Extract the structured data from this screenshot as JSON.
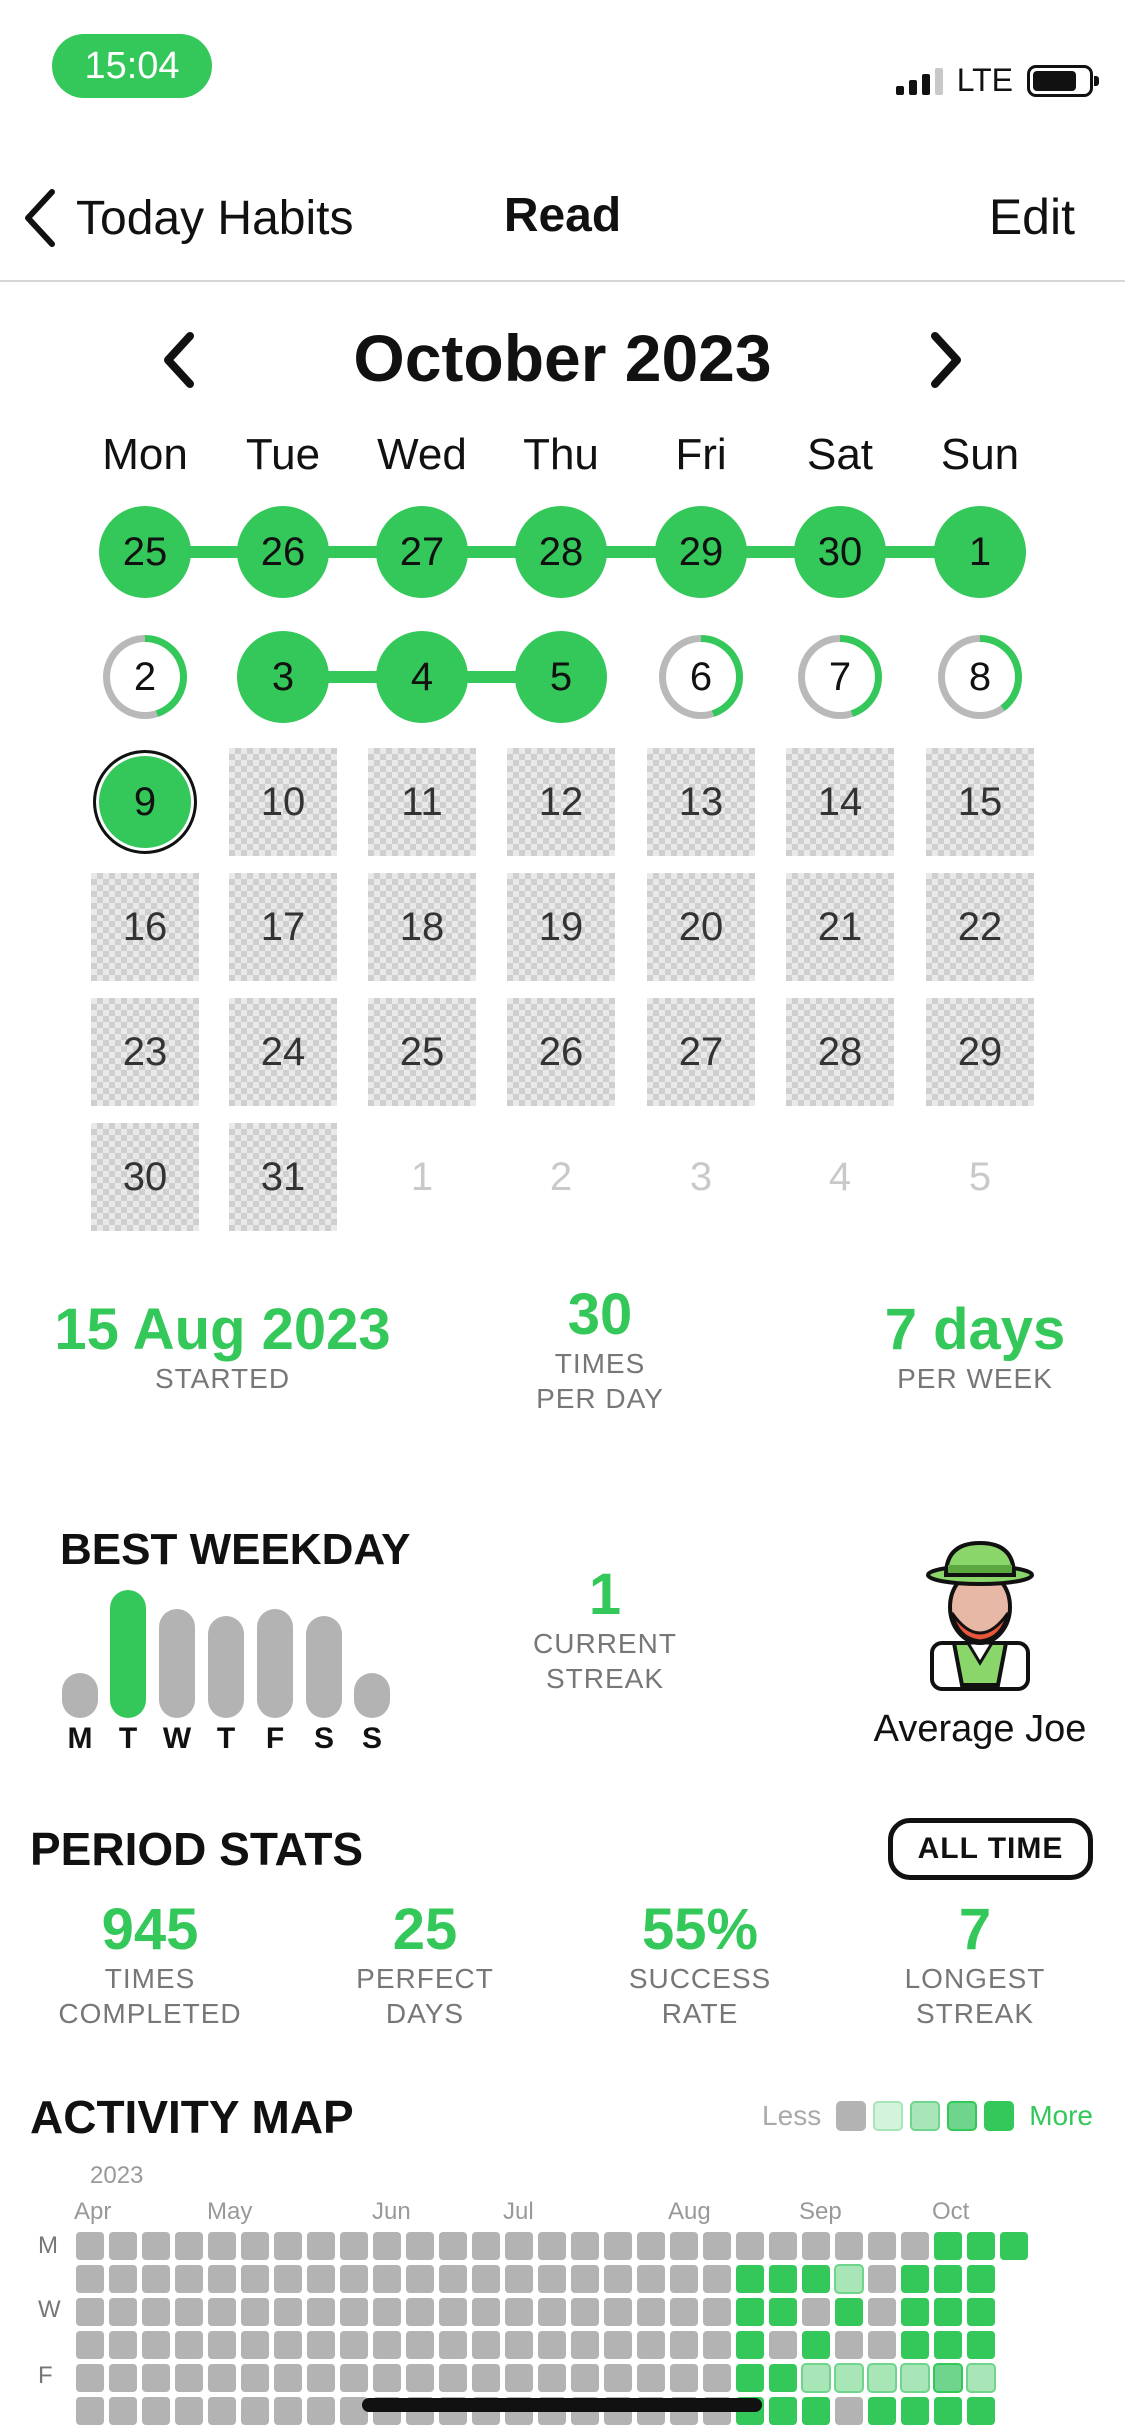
{
  "status": {
    "time": "15:04",
    "network": "LTE"
  },
  "nav": {
    "back_label": "Today Habits",
    "title": "Read",
    "edit_label": "Edit"
  },
  "calendar": {
    "month_title": "October 2023",
    "weekdays": [
      "Mon",
      "Tue",
      "Wed",
      "Thu",
      "Fri",
      "Sat",
      "Sun"
    ],
    "weeks": [
      [
        {
          "d": "25",
          "s": "done"
        },
        {
          "d": "26",
          "s": "done"
        },
        {
          "d": "27",
          "s": "done"
        },
        {
          "d": "28",
          "s": "done"
        },
        {
          "d": "29",
          "s": "done"
        },
        {
          "d": "30",
          "s": "done"
        },
        {
          "d": "1",
          "s": "done"
        }
      ],
      [
        {
          "d": "2",
          "s": "partial",
          "p": 0.45
        },
        {
          "d": "3",
          "s": "done"
        },
        {
          "d": "4",
          "s": "done"
        },
        {
          "d": "5",
          "s": "done"
        },
        {
          "d": "6",
          "s": "partial",
          "p": 0.45
        },
        {
          "d": "7",
          "s": "partial",
          "p": 0.45
        },
        {
          "d": "8",
          "s": "partial",
          "p": 0.4
        }
      ],
      [
        {
          "d": "9",
          "s": "today"
        },
        {
          "d": "10",
          "s": "future"
        },
        {
          "d": "11",
          "s": "future"
        },
        {
          "d": "12",
          "s": "future"
        },
        {
          "d": "13",
          "s": "future"
        },
        {
          "d": "14",
          "s": "future"
        },
        {
          "d": "15",
          "s": "future"
        }
      ],
      [
        {
          "d": "16",
          "s": "future"
        },
        {
          "d": "17",
          "s": "future"
        },
        {
          "d": "18",
          "s": "future"
        },
        {
          "d": "19",
          "s": "future"
        },
        {
          "d": "20",
          "s": "future"
        },
        {
          "d": "21",
          "s": "future"
        },
        {
          "d": "22",
          "s": "future"
        }
      ],
      [
        {
          "d": "23",
          "s": "future"
        },
        {
          "d": "24",
          "s": "future"
        },
        {
          "d": "25",
          "s": "future"
        },
        {
          "d": "26",
          "s": "future"
        },
        {
          "d": "27",
          "s": "future"
        },
        {
          "d": "28",
          "s": "future"
        },
        {
          "d": "29",
          "s": "future"
        }
      ],
      [
        {
          "d": "30",
          "s": "future"
        },
        {
          "d": "31",
          "s": "future"
        },
        {
          "d": "1",
          "s": "other"
        },
        {
          "d": "2",
          "s": "other"
        },
        {
          "d": "3",
          "s": "other"
        },
        {
          "d": "4",
          "s": "other"
        },
        {
          "d": "5",
          "s": "other"
        }
      ]
    ]
  },
  "summary": {
    "started_value": "15 Aug 2023",
    "started_label": "STARTED",
    "times_value": "30",
    "times_label_1": "TIMES",
    "times_label_2": "PER DAY",
    "days_value": "7 days",
    "days_label": "PER WEEK"
  },
  "best_weekday": {
    "title": "BEST WEEKDAY",
    "letters": [
      "M",
      "T",
      "W",
      "T",
      "F",
      "S",
      "S"
    ],
    "levels": [
      0.35,
      1.0,
      0.85,
      0.8,
      0.85,
      0.8,
      0.35
    ],
    "best_index": 1
  },
  "streak": {
    "value": "1",
    "label_1": "CURRENT",
    "label_2": "STREAK"
  },
  "avatar": {
    "label": "Average Joe",
    "icon": "avatar-person-hat-icon"
  },
  "period_stats": {
    "title": "PERIOD STATS",
    "filter_label": "ALL TIME",
    "items": [
      {
        "value": "945",
        "label_1": "TIMES",
        "label_2": "COMPLETED"
      },
      {
        "value": "25",
        "label_1": "PERFECT",
        "label_2": "DAYS"
      },
      {
        "value": "55%",
        "label_1": "SUCCESS",
        "label_2": "RATE"
      },
      {
        "value": "7",
        "label_1": "LONGEST",
        "label_2": "STREAK"
      }
    ]
  },
  "activity_map": {
    "title": "ACTIVITY MAP",
    "legend_less": "Less",
    "legend_more": "More",
    "legend_colors": [
      "#b3b3b3",
      "#d4f3dc",
      "#a8e6b8",
      "#6fd58c",
      "#34C759"
    ],
    "year": "2023",
    "months": [
      "Apr",
      "May",
      "Jun",
      "Jul",
      "Aug",
      "Sep",
      "Oct"
    ],
    "day_labels": [
      "M",
      "W",
      "F"
    ],
    "levels": [
      [
        0,
        0,
        0,
        0,
        0,
        0,
        0,
        0,
        0,
        0,
        0,
        0,
        0,
        0,
        0,
        0,
        0,
        0,
        0,
        0,
        0,
        0,
        0,
        0,
        0,
        0,
        4,
        4,
        4
      ],
      [
        0,
        0,
        0,
        0,
        0,
        0,
        0,
        0,
        0,
        0,
        0,
        0,
        0,
        0,
        0,
        0,
        0,
        0,
        0,
        0,
        4,
        4,
        4,
        2,
        0,
        4,
        4,
        4
      ],
      [
        0,
        0,
        0,
        0,
        0,
        0,
        0,
        0,
        0,
        0,
        0,
        0,
        0,
        0,
        0,
        0,
        0,
        0,
        0,
        0,
        4,
        4,
        0,
        4,
        0,
        4,
        4,
        4
      ],
      [
        0,
        0,
        0,
        0,
        0,
        0,
        0,
        0,
        0,
        0,
        0,
        0,
        0,
        0,
        0,
        0,
        0,
        0,
        0,
        0,
        4,
        0,
        4,
        0,
        0,
        4,
        4,
        4
      ],
      [
        0,
        0,
        0,
        0,
        0,
        0,
        0,
        0,
        0,
        0,
        0,
        0,
        0,
        0,
        0,
        0,
        0,
        0,
        0,
        0,
        4,
        4,
        2,
        2,
        2,
        2,
        3,
        2
      ],
      [
        0,
        0,
        0,
        0,
        0,
        0,
        0,
        0,
        0,
        0,
        0,
        0,
        0,
        0,
        0,
        0,
        0,
        0,
        0,
        0,
        4,
        4,
        4,
        0,
        4,
        4,
        4,
        4
      ]
    ]
  }
}
